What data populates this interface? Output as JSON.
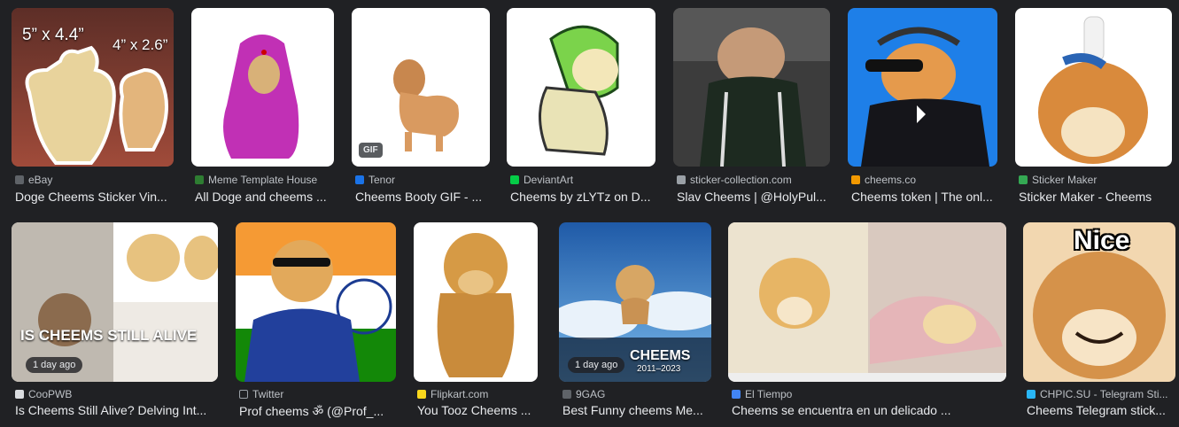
{
  "results": [
    {
      "source": "eBay",
      "title": "Doge Cheems Sticker Vin...",
      "fav": "#5f6368",
      "overlay": "5” x 4.4”",
      "overlay2": "4” x 2.6”"
    },
    {
      "source": "Meme Template House",
      "title": "All Doge and cheems ...",
      "fav": "#2e7d32"
    },
    {
      "source": "Tenor",
      "title": "Cheems Booty GIF - ...",
      "fav": "#1a73e8",
      "badge": "GIF"
    },
    {
      "source": "DeviantArt",
      "title": "Cheems by zLYTz on D...",
      "fav": "#05cc47"
    },
    {
      "source": "sticker-collection.com",
      "title": "Slav Cheems | @HolyPul...",
      "fav": "#9aa0a6"
    },
    {
      "source": "cheems.co",
      "title": "Cheems token | The onl...",
      "fav": "#f29900"
    },
    {
      "source": "Sticker Maker",
      "title": "Sticker Maker - Cheems",
      "fav": "#34a853"
    },
    {
      "source": "CooPWB",
      "title": "Is Cheems Still Alive? Delving Int...",
      "fav": "#dadce0",
      "overlay": "IS CHEEMS STILL ALIVE",
      "time": "1 day ago"
    },
    {
      "source": "Twitter",
      "title": "Prof cheems ॐ (@Prof_...",
      "fav": "#202124",
      "icon": "x-logo-icon"
    },
    {
      "source": "Flipkart.com",
      "title": "You Tooz Cheems ...",
      "fav": "#f9d71c"
    },
    {
      "source": "9GAG",
      "title": "Best Funny cheems Me...",
      "fav": "#5f6368",
      "overlay": "CHEEMS",
      "overlay2": "2011–2023",
      "time": "1 day ago"
    },
    {
      "source": "El Tiempo",
      "title": "Cheems se encuentra en un delicado ...",
      "fav": "#4285f4"
    },
    {
      "source": "CHPIC.SU - Telegram Sti...",
      "title": "Cheems Telegram stick...",
      "fav": "#29b6f6",
      "overlay": "Nice"
    }
  ]
}
